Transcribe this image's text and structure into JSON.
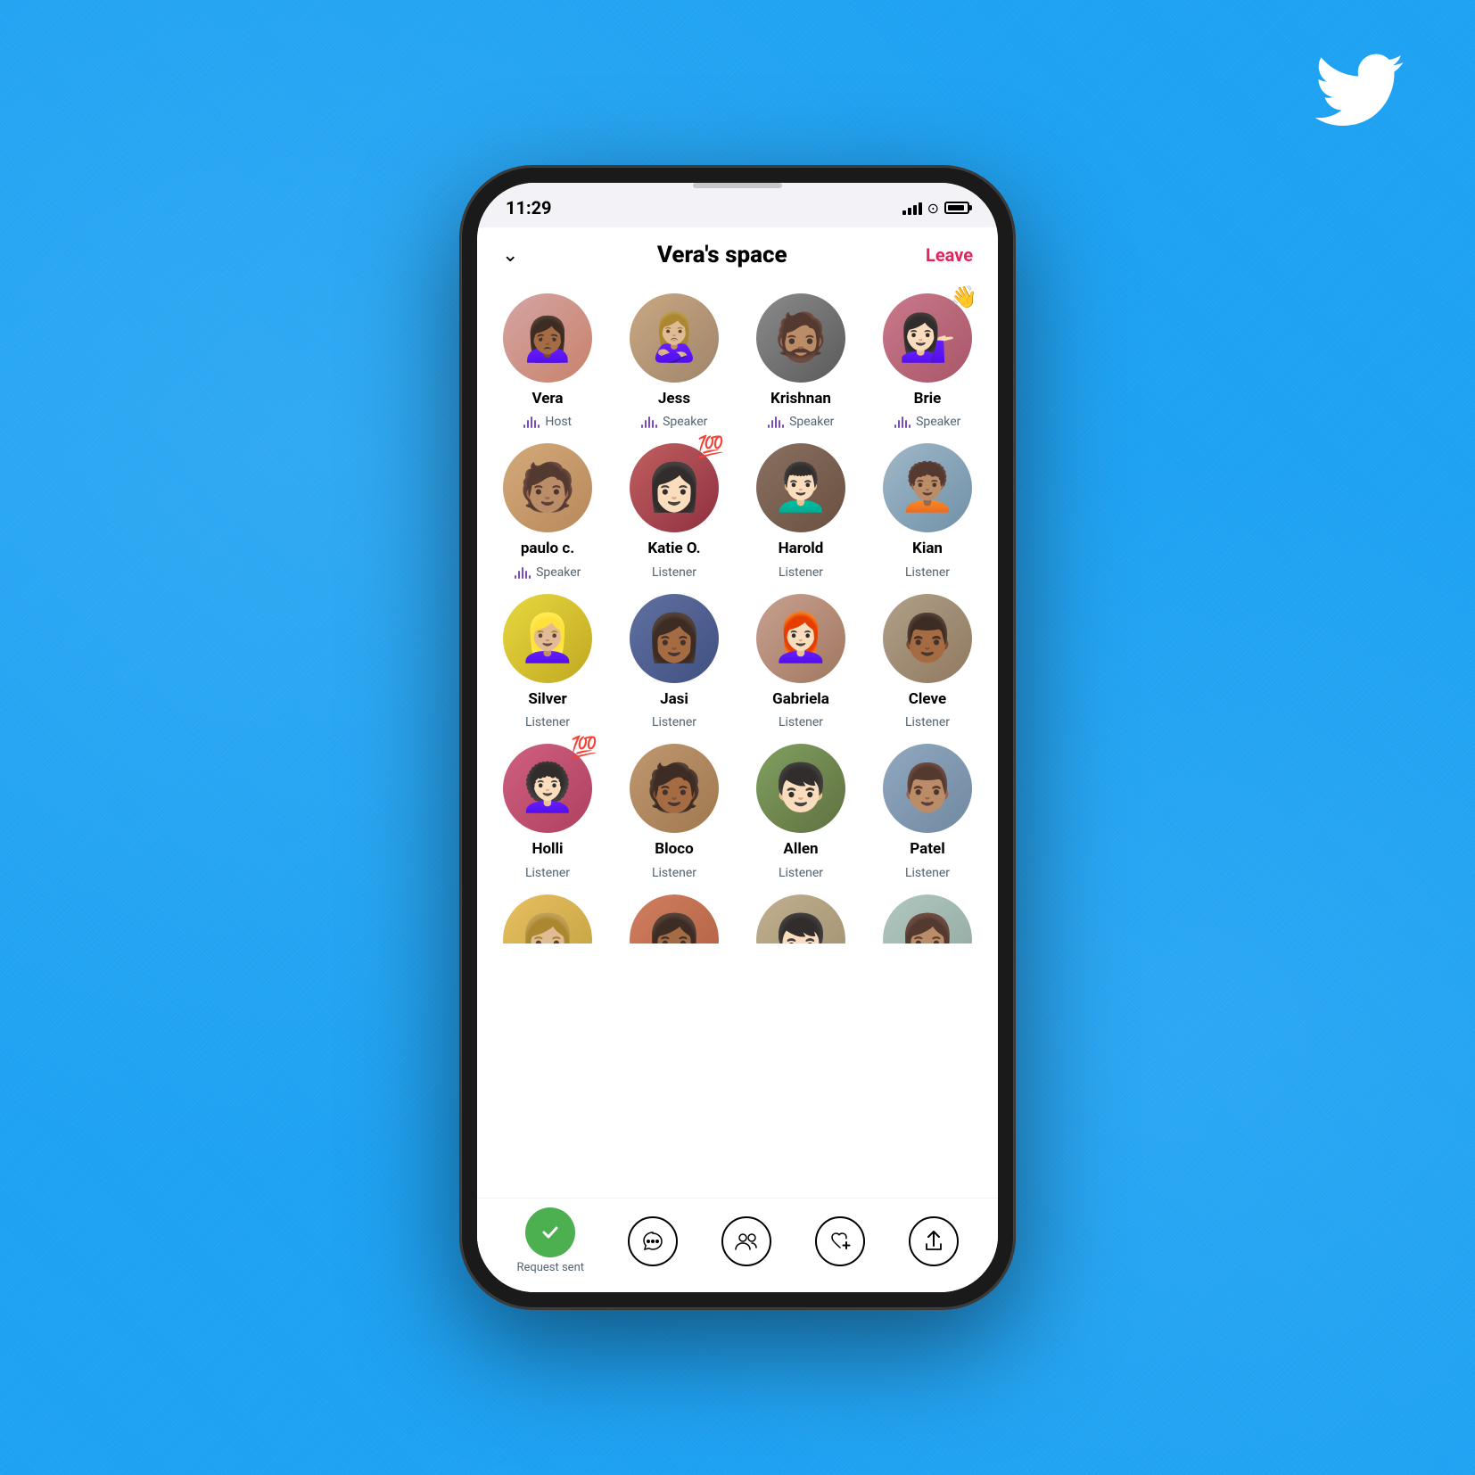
{
  "background": {
    "color": "#1DA1F2"
  },
  "statusBar": {
    "time": "11:29",
    "batteryIcon": "battery"
  },
  "header": {
    "chevronLabel": "chevron",
    "title": "Vera's space",
    "leaveLabel": "Leave"
  },
  "participants": [
    {
      "id": "vera",
      "name": "Vera",
      "role": "Host",
      "isSpeaker": true,
      "emoji": null,
      "avatarClass": "av-vera",
      "icon": "👩🏾"
    },
    {
      "id": "jess",
      "name": "Jess",
      "role": "Speaker",
      "isSpeaker": true,
      "emoji": null,
      "avatarClass": "av-jess",
      "icon": "👩🏼"
    },
    {
      "id": "krishnan",
      "name": "Krishnan",
      "role": "Speaker",
      "isSpeaker": true,
      "emoji": null,
      "avatarClass": "av-krishnan",
      "icon": "👨🏽"
    },
    {
      "id": "brie",
      "name": "Brie",
      "role": "Speaker",
      "isSpeaker": true,
      "emoji": "👋",
      "avatarClass": "av-brie",
      "icon": "👩🏻"
    },
    {
      "id": "paulo",
      "name": "paulo c.",
      "role": "Speaker",
      "isSpeaker": true,
      "emoji": null,
      "avatarClass": "av-paulo",
      "icon": "👨🏽"
    },
    {
      "id": "katie",
      "name": "Katie O.",
      "role": "Listener",
      "isSpeaker": false,
      "emoji": "💯",
      "avatarClass": "av-katie",
      "icon": "👩🏻"
    },
    {
      "id": "harold",
      "name": "Harold",
      "role": "Listener",
      "isSpeaker": false,
      "emoji": null,
      "avatarClass": "av-harold",
      "icon": "👨🏻"
    },
    {
      "id": "kian",
      "name": "Kian",
      "role": "Listener",
      "isSpeaker": false,
      "emoji": null,
      "avatarClass": "av-kian",
      "icon": "👦🏽"
    },
    {
      "id": "silver",
      "name": "Silver",
      "role": "Listener",
      "isSpeaker": false,
      "emoji": null,
      "avatarClass": "av-silver",
      "icon": "👩🏼"
    },
    {
      "id": "jasi",
      "name": "Jasi",
      "role": "Listener",
      "isSpeaker": false,
      "emoji": null,
      "avatarClass": "av-jasi",
      "icon": "👩🏾"
    },
    {
      "id": "gabriela",
      "name": "Gabriela",
      "role": "Listener",
      "isSpeaker": false,
      "emoji": null,
      "avatarClass": "av-gabriela",
      "icon": "👩🏻"
    },
    {
      "id": "cleve",
      "name": "Cleve",
      "role": "Listener",
      "isSpeaker": false,
      "emoji": null,
      "avatarClass": "av-cleve",
      "icon": "👨🏾"
    },
    {
      "id": "holli",
      "name": "Holli",
      "role": "Listener",
      "isSpeaker": false,
      "emoji": "💯",
      "avatarClass": "av-holli",
      "icon": "👩🏻"
    },
    {
      "id": "bloco",
      "name": "Bloco",
      "role": "Listener",
      "isSpeaker": false,
      "emoji": null,
      "avatarClass": "av-bloco",
      "icon": "👨🏾"
    },
    {
      "id": "allen",
      "name": "Allen",
      "role": "Listener",
      "isSpeaker": false,
      "emoji": null,
      "avatarClass": "av-allen",
      "icon": "👦🏻"
    },
    {
      "id": "patel",
      "name": "Patel",
      "role": "Listener",
      "isSpeaker": false,
      "emoji": null,
      "avatarClass": "av-patel",
      "icon": "👨🏽"
    }
  ],
  "partialParticipants": [
    {
      "id": "partial1",
      "avatarClass": "av-partial1",
      "icon": "👩🏼"
    },
    {
      "id": "partial2",
      "avatarClass": "av-partial2",
      "icon": "👩🏾"
    },
    {
      "id": "partial3",
      "avatarClass": "av-partial3",
      "icon": "👦🏻"
    },
    {
      "id": "partial4",
      "avatarClass": "av-partial4",
      "icon": "👩🏽"
    }
  ],
  "toolbar": {
    "requestSentLabel": "Request sent",
    "buttons": [
      {
        "id": "request",
        "icon": "✓",
        "type": "green-circle",
        "label": "Request sent"
      },
      {
        "id": "chat",
        "icon": "···",
        "type": "border-circle",
        "label": ""
      },
      {
        "id": "people",
        "icon": "👥",
        "type": "icon",
        "label": ""
      },
      {
        "id": "heart",
        "icon": "♡+",
        "type": "icon",
        "label": ""
      },
      {
        "id": "share",
        "icon": "↑",
        "type": "icon",
        "label": ""
      }
    ]
  }
}
